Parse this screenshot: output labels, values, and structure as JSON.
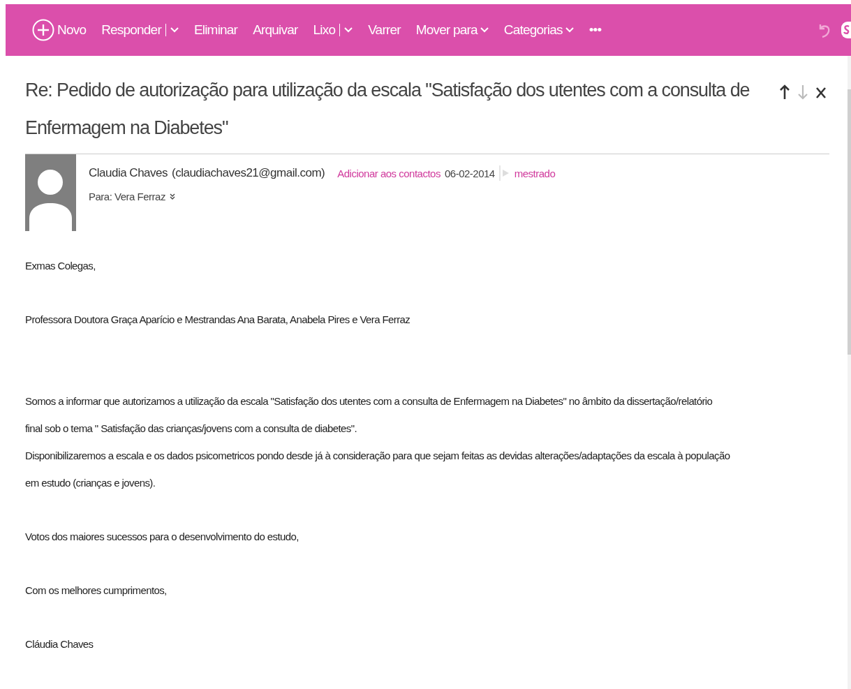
{
  "toolbar": {
    "items": [
      {
        "label": "Novo",
        "kind": "new"
      },
      {
        "label": "Responder",
        "kind": "split"
      },
      {
        "label": "Eliminar",
        "kind": "plain"
      },
      {
        "label": "Arquivar",
        "kind": "plain"
      },
      {
        "label": "Lixo",
        "kind": "split"
      },
      {
        "label": "Varrer",
        "kind": "plain"
      },
      {
        "label": "Mover para",
        "kind": "dropdown"
      },
      {
        "label": "Categorias",
        "kind": "dropdown"
      },
      {
        "label": "•••",
        "kind": "plain"
      }
    ]
  },
  "message": {
    "subject": "Re: Pedido de autorização para utilização da escala \"Satisfação dos utentes com a consulta de Enfermagem na Diabetes\"",
    "sender_name": "Claudia Chaves",
    "sender_email": "(claudiachaves21@gmail.com)",
    "add_contact": "Adicionar aos contactos",
    "date": "06-02-2014",
    "category": "mestrado",
    "to": "Para: Vera Ferraz",
    "body": [
      {
        "lines": [
          "Exmas Colegas,"
        ]
      },
      {
        "lines": [
          "Professora Doutora Graça Aparício e Mestrandas Ana Barata, Anabela Pires e Vera Ferraz"
        ]
      },
      {
        "lines": [
          "Somos a informar que autorizamos a utilização da escala \"Satisfação dos utentes com a consulta de Enfermagem na Diabetes\" no âmbito da dissertação/relatório final sob o tema \" Satisfação das crianças/jovens com a consulta de diabetes\".",
          "Disponibilizaremos a escala e os dados psicometricos pondo desde já à consideração para que sejam feitas as devidas alterações/adaptações da escala à população em estudo (crianças e jovens)."
        ]
      },
      {
        "lines": [
          "Votos dos maiores sucessos para o desenvolvimento do estudo,"
        ]
      },
      {
        "lines": [
          "Com os melhores cumprimentos,"
        ]
      },
      {
        "lines": [
          "Cláudia Chaves"
        ]
      }
    ]
  }
}
